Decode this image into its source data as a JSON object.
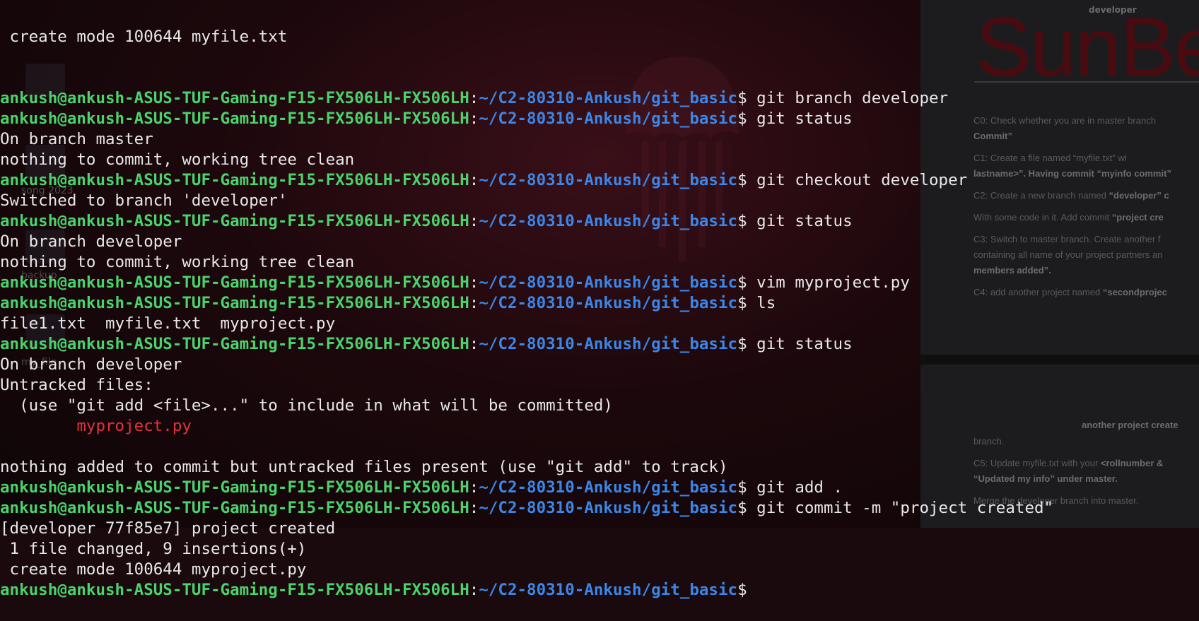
{
  "prompt": {
    "user": "ankush@ankush-ASUS-TUF-Gaming-F15-FX506LH-FX506LH",
    "sep": ":",
    "path": "~/C2-80310-Ankush/git_basic",
    "dollar": "$"
  },
  "terminal": {
    "first_partial": " create mode 100644 myfile.txt",
    "lines": [
      {
        "type": "cmd",
        "text": " git branch developer"
      },
      {
        "type": "cmd",
        "text": " git status"
      },
      {
        "type": "out",
        "text": "On branch master"
      },
      {
        "type": "out",
        "text": "nothing to commit, working tree clean"
      },
      {
        "type": "cmd",
        "text": " git checkout developer"
      },
      {
        "type": "out",
        "text": "Switched to branch 'developer'"
      },
      {
        "type": "cmd",
        "text": " git status"
      },
      {
        "type": "out",
        "text": "On branch developer"
      },
      {
        "type": "out",
        "text": "nothing to commit, working tree clean"
      },
      {
        "type": "cmd",
        "text": " vim myproject.py"
      },
      {
        "type": "cmd",
        "text": " ls"
      },
      {
        "type": "out",
        "text": "file1.txt  myfile.txt  myproject.py"
      },
      {
        "type": "cmd",
        "text": " git status"
      },
      {
        "type": "out",
        "text": "On branch developer"
      },
      {
        "type": "out",
        "text": "Untracked files:"
      },
      {
        "type": "out",
        "text": "  (use \"git add <file>...\" to include in what will be committed)"
      },
      {
        "type": "untracked",
        "text": "        myproject.py"
      },
      {
        "type": "out",
        "text": ""
      },
      {
        "type": "out",
        "text": "nothing added to commit but untracked files present (use \"git add\" to track)"
      },
      {
        "type": "cmd",
        "text": " git add ."
      },
      {
        "type": "cmd",
        "text": " git commit -m \"project created\""
      },
      {
        "type": "out",
        "text": "[developer 77f85e7] project created"
      },
      {
        "type": "out",
        "text": " 1 file changed, 9 insertions(+)"
      },
      {
        "type": "out",
        "text": " create mode 100644 myproject.py"
      },
      {
        "type": "cmd",
        "text": ""
      }
    ]
  },
  "desktop": {
    "labels": [
      "song 2023",
      "backup",
      "my_file"
    ]
  },
  "document": {
    "top_label": "developer",
    "logo_text": "SunBe",
    "lines": [
      {
        "pre": "C0: Check whether you are in master branch",
        "bold": ""
      },
      {
        "pre": "",
        "bold": "Commit”"
      },
      {
        "pre": "C1: Create a file named “myfile.txt” wi",
        "bold": ""
      },
      {
        "pre": "",
        "bold": "lastname>”. Having commit “myinfo commit”"
      },
      {
        "pre": "C2: Create a new branch named ",
        "bold": "“developer” c"
      },
      {
        "pre": "With some code in it. Add commit ",
        "bold": "“project cre"
      },
      {
        "pre": "C3: Switch to master branch. Create another f",
        "bold": ""
      },
      {
        "pre": "containing all name of your project partners an",
        "bold": ""
      },
      {
        "pre": "",
        "bold": "members added”."
      },
      {
        "pre": "C4: add another project named ",
        "bold": "“secondprojec"
      },
      {
        "pre": "",
        "bold": "another project create"
      },
      {
        "pre": "branch.",
        "bold": ""
      },
      {
        "pre": "C5: Update myfile.txt with your ",
        "bold": "<rollnumber &"
      },
      {
        "pre": "",
        "bold": "“Updated my info” under master."
      },
      {
        "pre": "Merge the developer branch into master.",
        "bold": ""
      }
    ]
  },
  "colors": {
    "prompt_user": "#4ad26b",
    "prompt_path": "#3b86e8",
    "untracked": "#e0343d",
    "text": "#e8e8e8"
  }
}
